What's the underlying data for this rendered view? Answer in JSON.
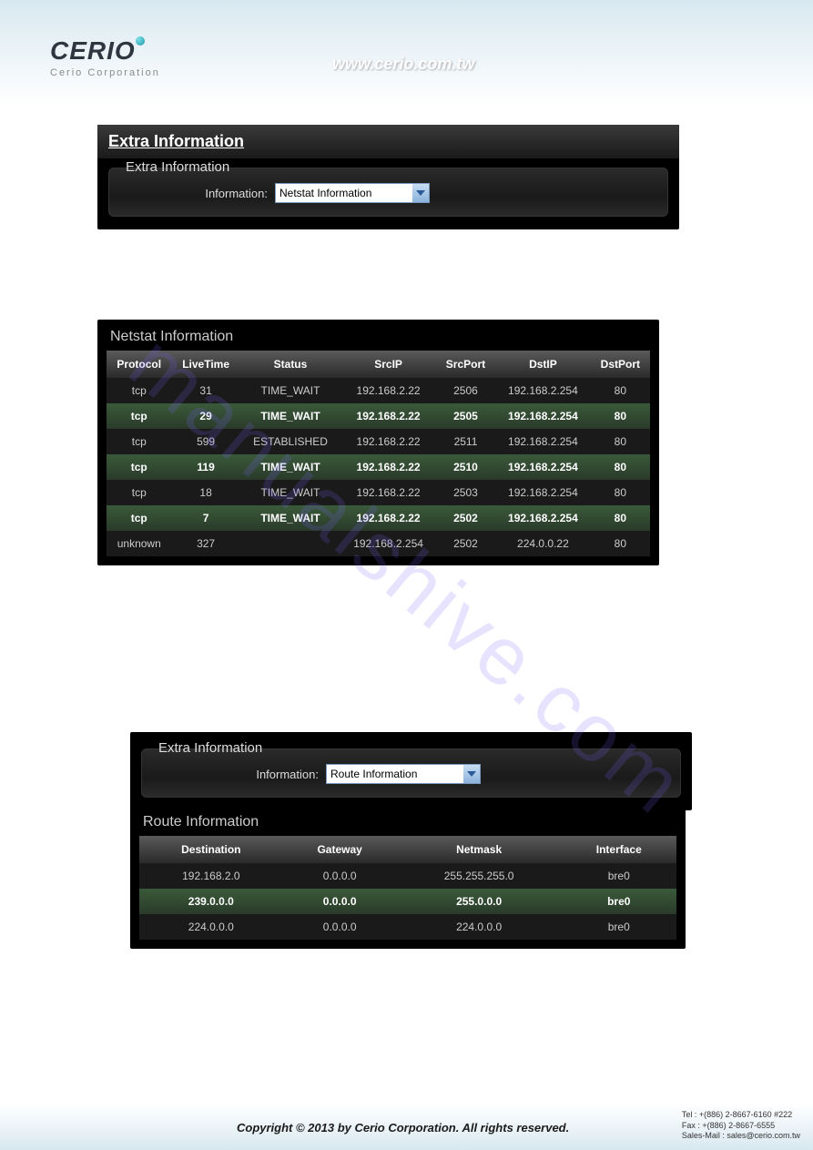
{
  "header": {
    "brand": "CERIO",
    "subbrand": "Cerio Corporation",
    "url": "www.cerio.com.tw"
  },
  "panel1": {
    "title": "Extra Information",
    "legend": "Extra Information",
    "label": "Information:",
    "select_value": "Netstat Information"
  },
  "netstat": {
    "title": "Netstat Information",
    "headers": [
      "Protocol",
      "LiveTime",
      "Status",
      "SrcIP",
      "SrcPort",
      "DstIP",
      "DstPort"
    ],
    "rows": [
      [
        "tcp",
        "31",
        "TIME_WAIT",
        "192.168.2.22",
        "2506",
        "192.168.2.254",
        "80"
      ],
      [
        "tcp",
        "29",
        "TIME_WAIT",
        "192.168.2.22",
        "2505",
        "192.168.2.254",
        "80"
      ],
      [
        "tcp",
        "599",
        "ESTABLISHED",
        "192.168.2.22",
        "2511",
        "192.168.2.254",
        "80"
      ],
      [
        "tcp",
        "119",
        "TIME_WAIT",
        "192.168.2.22",
        "2510",
        "192.168.2.254",
        "80"
      ],
      [
        "tcp",
        "18",
        "TIME_WAIT",
        "192.168.2.22",
        "2503",
        "192.168.2.254",
        "80"
      ],
      [
        "tcp",
        "7",
        "TIME_WAIT",
        "192.168.2.22",
        "2502",
        "192.168.2.254",
        "80"
      ],
      [
        "unknown",
        "327",
        "",
        "192.168.2.254",
        "2502",
        "224.0.0.22",
        "80"
      ]
    ]
  },
  "panel2": {
    "legend": "Extra Information",
    "label": "Information:",
    "select_value": "Route Information"
  },
  "route": {
    "title": "Route Information",
    "headers": [
      "Destination",
      "Gateway",
      "Netmask",
      "Interface"
    ],
    "rows": [
      [
        "192.168.2.0",
        "0.0.0.0",
        "255.255.255.0",
        "bre0"
      ],
      [
        "239.0.0.0",
        "0.0.0.0",
        "255.0.0.0",
        "bre0"
      ],
      [
        "224.0.0.0",
        "0.0.0.0",
        "224.0.0.0",
        "bre0"
      ]
    ]
  },
  "watermark": "manualshive.com",
  "footer": {
    "copyright": "Copyright © 2013 by Cerio Corporation. All rights reserved.",
    "tel": "Tel : +(886) 2-8667-6160 #222",
    "fax": "Fax : +(886) 2-8667-6555",
    "mail": "Sales-Mail : sales@cerio.com.tw"
  }
}
